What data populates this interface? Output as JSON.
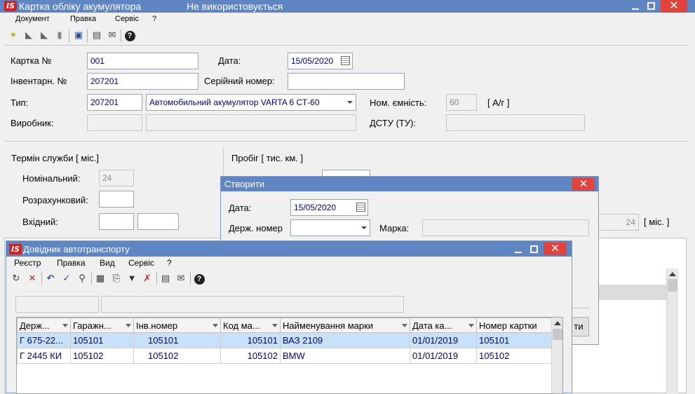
{
  "main": {
    "title": "Картка обліку акумулятора",
    "status": "Не використовується",
    "menu": [
      "Документ",
      "Правка",
      "Сервіс",
      "?"
    ],
    "toolbar_icons": [
      "new-icon",
      "open-icon",
      "copy-icon",
      "delete-icon",
      "save-icon",
      "preview-icon",
      "mail-icon",
      "help-icon"
    ],
    "labels": {
      "card_no": "Картка №",
      "date": "Дата:",
      "inventory_no": "Інвентарн. №",
      "serial_no": "Серійний номер:",
      "type": "Тип:",
      "nominal_capacity": "Ном. ємність:",
      "capacity_unit": "[ А/г ]",
      "manufacturer": "Виробник:",
      "dstu": "ДСТУ (ТУ):",
      "service_life": "Термін служби [ міс.]",
      "nominal": "Номінальний:",
      "calculated": "Розрахунковий:",
      "incoming": "Вхідний:",
      "mileage": "Пробіг [ тис. км. ]",
      "months_unit": "[ міс. ]"
    },
    "values": {
      "card_no": "001",
      "date": "15/05/2020",
      "inventory_no": "207201",
      "serial_no": "",
      "type_code": "207201",
      "type_name": "Автомобильний акумулятор VARTA 6 СТ-60",
      "nominal_capacity": "60",
      "nominal_life": "24",
      "right_months": "24"
    }
  },
  "create_dialog": {
    "title": "Створити",
    "date_label": "Дата:",
    "date_value": "15/05/2020",
    "plate_label": "Держ. номер",
    "brand_label": "Марка:",
    "button_partial": "ти"
  },
  "directory": {
    "title": "Довідник автотранспорту",
    "menu": [
      "Реєстр",
      "Правка",
      "Вид",
      "Сервіс",
      "?"
    ],
    "toolbar_icons": [
      "refresh-icon",
      "delete-icon",
      "undo-icon",
      "check-icon",
      "search-icon",
      "grid-icon",
      "export-icon",
      "filter-icon",
      "clear-filter-icon",
      "preview-icon",
      "mail-icon",
      "help-icon"
    ],
    "columns": [
      "Держ...",
      "Гаражн...",
      "Інв.номер",
      "Код ма...",
      "Найменування марки",
      "Дата ка...",
      "Номер картки"
    ],
    "rows": [
      [
        "Г 675-22...",
        "105101",
        "105101",
        "105101",
        "ВАЗ 2109",
        "01/01/2019",
        "105101"
      ],
      [
        "Г 2445 КИ",
        "105102",
        "105102",
        "105102",
        "BMW",
        "01/01/2019",
        "105102"
      ]
    ]
  },
  "colors": {
    "titlebar": "#5f86c3",
    "close": "#e0443d",
    "selection": "#c8e0f8",
    "value_text": "#000080"
  }
}
